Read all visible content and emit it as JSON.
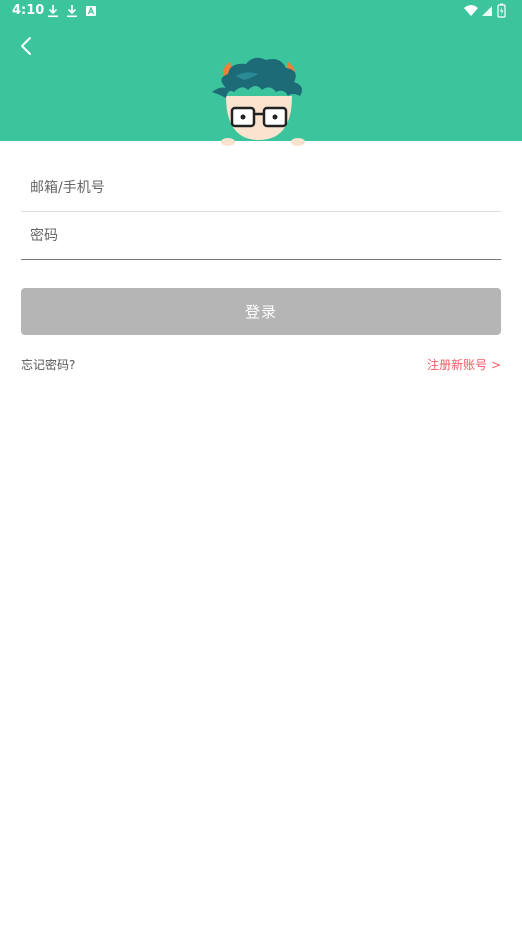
{
  "status_bar": {
    "time": "4:10",
    "icons": [
      "download-icon",
      "download-icon",
      "app-a-icon",
      "wifi-icon",
      "signal-icon",
      "battery-icon"
    ]
  },
  "header": {
    "background_color": "#3cc49d",
    "back_icon": "chevron-left-icon",
    "mascot": "cartoon-boy-with-glasses"
  },
  "login_form": {
    "account_placeholder": "邮箱/手机号",
    "password_placeholder": "密码",
    "login_button": "登录",
    "login_button_color": "#b5b5b5",
    "forgot_password": "忘记密码?",
    "register": "注册新账号 >",
    "register_color": "#f05a64"
  }
}
